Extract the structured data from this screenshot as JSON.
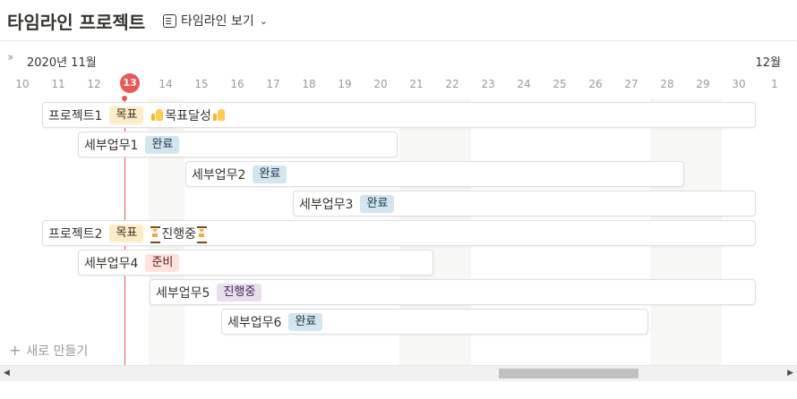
{
  "header": {
    "title": "타임라인 프로젝트",
    "view_label": "타임라인 보기"
  },
  "timeline": {
    "month_left": "2020년 11월",
    "month_right": "12월",
    "days": [
      "10",
      "11",
      "12",
      "13",
      "14",
      "15",
      "16",
      "17",
      "18",
      "19",
      "20",
      "21",
      "22",
      "23",
      "24",
      "25",
      "26",
      "27",
      "28",
      "29",
      "30",
      "1"
    ],
    "today": "13"
  },
  "items": [
    {
      "label": "프로젝트1",
      "tag": "목표",
      "extra_text": "목표달성"
    },
    {
      "label": "세부업무1",
      "tag": "완료"
    },
    {
      "label": "세부업무2",
      "tag": "완료"
    },
    {
      "label": "세부업무3",
      "tag": "완료"
    },
    {
      "label": "프로젝트2",
      "tag": "목표",
      "extra_text": "진행중"
    },
    {
      "label": "세부업무4",
      "tag": "준비"
    },
    {
      "label": "세부업무5",
      "tag": "진행중"
    },
    {
      "label": "세부업무6",
      "tag": "완료"
    }
  ],
  "new_item_label": "새로 만들기",
  "colors": {
    "today_accent": "#eb5757",
    "tag_goal_bg": "#fdecc8",
    "tag_done_bg": "#d3e5ef",
    "tag_ready_bg": "#ffe2dd",
    "tag_progress_bg": "#e8deee"
  },
  "icons": {
    "view": "timeline-view-icon",
    "collapse": "double-chevron-right-icon",
    "goal_done": "thumbs-up-icon",
    "in_progress": "hourglass-icon",
    "new": "plus-icon"
  }
}
